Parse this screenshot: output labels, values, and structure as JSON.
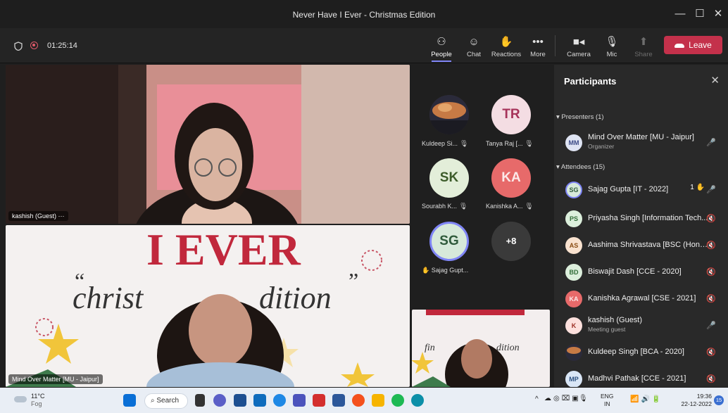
{
  "window": {
    "title": "Never Have I Ever - Christmas Edition",
    "minimize": "—",
    "maximize": "☐",
    "close": "✕"
  },
  "toolbar": {
    "timer": "01:25:14",
    "people": "People",
    "chat": "Chat",
    "reactions": "Reactions",
    "more": "More",
    "camera": "Camera",
    "mic": "Mic",
    "share": "Share",
    "leave": "Leave"
  },
  "stage": {
    "tile1_name": "kashish (Guest)",
    "tile1_more": "···",
    "tile2_name": "Mind Over Matter [MU - Jaipur]",
    "slide_title": "I EVER",
    "slide_script_left": "christ",
    "slide_script_right": "dition",
    "slide_quote_l": "“",
    "slide_quote_r": "”",
    "mini_script_l": "fin",
    "mini_script_r": "dition"
  },
  "gallery": [
    {
      "initials": "",
      "label": "Kuldeep Si...",
      "bg": "#3a2c22",
      "color": "#fff"
    },
    {
      "initials": "TR",
      "label": "Tanya Raj [...",
      "bg": "#f4dde3",
      "color": "#a6335a"
    },
    {
      "initials": "SK",
      "label": "Sourabh K...",
      "bg": "#e3eed9",
      "color": "#3d5c2a"
    },
    {
      "initials": "KA",
      "label": "Kanishka A...",
      "bg": "#e76a6a",
      "color": "#fbe9e9"
    },
    {
      "initials": "SG",
      "label": "Sajag Gupt...",
      "bg": "#d7e9da",
      "color": "#2f5a3b"
    },
    {
      "initials": "+8",
      "label": "",
      "bg": "#3a3a3a",
      "color": "#fff"
    }
  ],
  "panel": {
    "title": "Participants",
    "presenters": "▾ Presenters (1)",
    "attendees": "▾ Attendees (15)",
    "rows": [
      {
        "initials": "MM",
        "name": "Mind Over Matter [MU - Jaipur]",
        "sub": "Organizer",
        "avbg": "#dfe4f3",
        "avfg": "#3c4a86",
        "mic": "on"
      },
      {
        "initials": "SG",
        "name": "Sajag Gupta [IT - 2022]",
        "sub": "",
        "avbg": "#d7e9da",
        "avfg": "#2f5a3b",
        "mic": "on",
        "hand": "1"
      },
      {
        "initials": "PS",
        "name": "Priyasha Singh [Information Tech...",
        "sub": "",
        "avbg": "#dcefdc",
        "avfg": "#2f6b36",
        "mic": "off"
      },
      {
        "initials": "AS",
        "name": "Aashima Shrivastava [BSC (Hons ...",
        "sub": "",
        "avbg": "#f9e2cf",
        "avfg": "#8a4b12",
        "mic": "off"
      },
      {
        "initials": "BD",
        "name": "Biswajit Dash [CCE - 2020]",
        "sub": "",
        "avbg": "#dcefdc",
        "avfg": "#2f6b36",
        "mic": "off"
      },
      {
        "initials": "KA",
        "name": "Kanishka Agrawal [CSE - 2021]",
        "sub": "",
        "avbg": "#e76a6a",
        "avfg": "#fbe9e9",
        "mic": "off"
      },
      {
        "initials": "K",
        "name": "kashish (Guest)",
        "sub": "Meeting guest",
        "avbg": "#fde0dd",
        "avfg": "#9c2f24",
        "mic": "on"
      },
      {
        "initials": "",
        "name": "Kuldeep Singh [BCA - 2020]",
        "sub": "",
        "avbg": "#3a2c22",
        "avfg": "#fff",
        "mic": "off"
      },
      {
        "initials": "MP",
        "name": "Madhvi Pathak [CCE - 2021]",
        "sub": "",
        "avbg": "#d9e6f6",
        "avfg": "#2a4f7f",
        "mic": "off"
      }
    ]
  },
  "taskbar": {
    "weather_temp": "11°C",
    "weather_desc": "Fog",
    "search": "Search",
    "lang1": "ENG",
    "lang2": "IN",
    "time": "19:36",
    "date": "22-12-2022",
    "notif": "15"
  }
}
